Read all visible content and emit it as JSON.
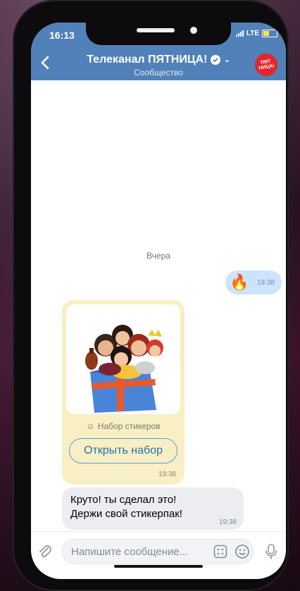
{
  "status": {
    "time": "16:13",
    "network": "LTE"
  },
  "header": {
    "title": "Телеканал ПЯТНИЦА!",
    "subtitle": "Сообщество",
    "avatar_text": "ПЯТ НИЦА!"
  },
  "chat": {
    "date_divider": "Вчера",
    "outgoing": {
      "emoji": "🔥",
      "time": "19:38"
    },
    "sticker_card": {
      "set_label": "Набор стикеров",
      "button_label": "Открыть набор",
      "time": "19:38"
    },
    "incoming": {
      "text": "Круто! ты сделал это!\nДержи свой стикерпак!",
      "time": "19:38"
    }
  },
  "composer": {
    "placeholder": "Напишите сообщение..."
  },
  "colors": {
    "header_bg": "#5181b8",
    "outgoing_bubble": "#cce4ff",
    "sticker_card_bg": "#f8efc4",
    "incoming_bubble": "#ebedf0"
  }
}
